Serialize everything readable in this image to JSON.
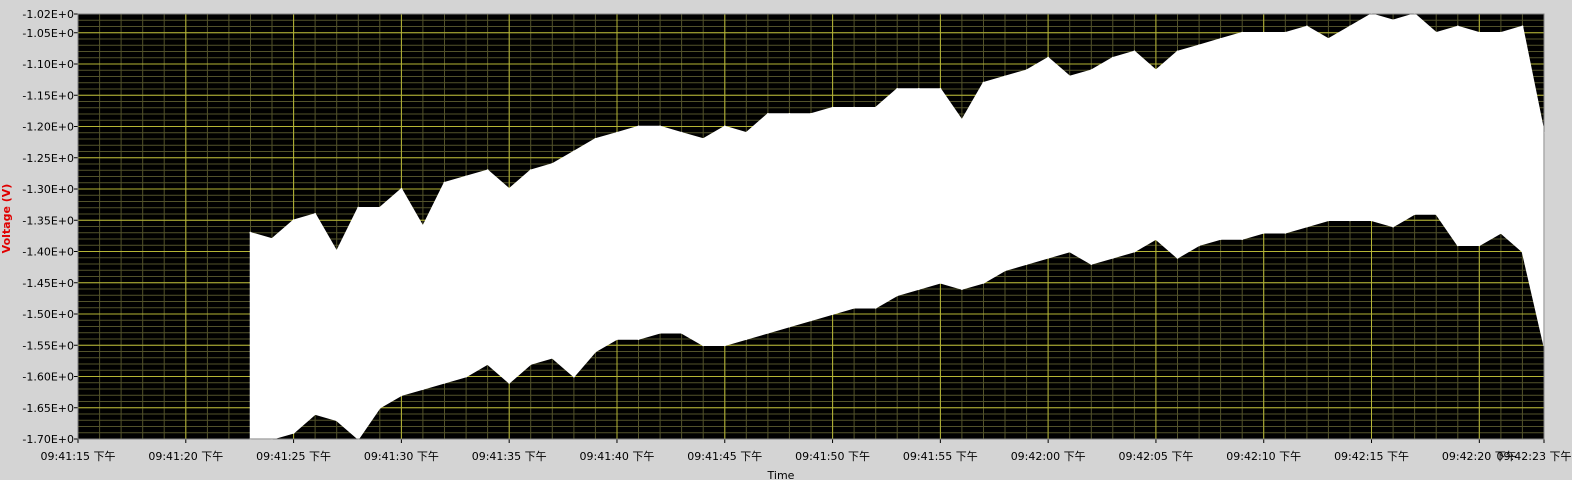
{
  "chart_data": {
    "type": "area",
    "xlabel": "Time",
    "ylabel": "Voltage (V)",
    "ylim": [
      -1.7,
      -1.02
    ],
    "xlim": [
      "09:41:15",
      "09:42:23"
    ],
    "y_ticks": [
      "-1.02E+0",
      "-1.05E+0",
      "-1.10E+0",
      "-1.15E+0",
      "-1.20E+0",
      "-1.25E+0",
      "-1.30E+0",
      "-1.35E+0",
      "-1.40E+0",
      "-1.45E+0",
      "-1.50E+0",
      "-1.55E+0",
      "-1.60E+0",
      "-1.65E+0",
      "-1.70E+0"
    ],
    "x_ticks": [
      "09:41:15 下午",
      "09:41:20 下午",
      "09:41:25 下午",
      "09:41:30 下午",
      "09:41:35 下午",
      "09:41:40 下午",
      "09:41:45 下午",
      "09:41:50 下午",
      "09:41:55 下午",
      "09:42:00 下午",
      "09:42:05 下午",
      "09:42:10 下午",
      "09:42:15 下午",
      "09:42:20 下午",
      "09:42:23 下午"
    ],
    "grid": true,
    "colors": {
      "plot_bg": "#000000",
      "grid_major": "#b5b535",
      "grid_minor": "#52522a",
      "series": "#ffffff",
      "ylabel": "#e00000",
      "frame": "#d4d4d4"
    },
    "series": [
      {
        "kind": "envelope",
        "x": [
          "09:41:23",
          "09:41:24",
          "09:41:25",
          "09:41:26",
          "09:41:27",
          "09:41:28",
          "09:41:29",
          "09:41:30",
          "09:41:31",
          "09:41:32",
          "09:41:33",
          "09:41:34",
          "09:41:35",
          "09:41:36",
          "09:41:37",
          "09:41:38",
          "09:41:39",
          "09:41:40",
          "09:41:41",
          "09:41:42",
          "09:41:43",
          "09:41:44",
          "09:41:45",
          "09:41:46",
          "09:41:47",
          "09:41:48",
          "09:41:49",
          "09:41:50",
          "09:41:51",
          "09:41:52",
          "09:41:53",
          "09:41:54",
          "09:41:55",
          "09:41:56",
          "09:41:57",
          "09:41:58",
          "09:41:59",
          "09:42:00",
          "09:42:01",
          "09:42:02",
          "09:42:03",
          "09:42:04",
          "09:42:05",
          "09:42:06",
          "09:42:07",
          "09:42:08",
          "09:42:09",
          "09:42:10",
          "09:42:11",
          "09:42:12",
          "09:42:13",
          "09:42:14",
          "09:42:15",
          "09:42:16",
          "09:42:17",
          "09:42:18",
          "09:42:19",
          "09:42:20",
          "09:42:21",
          "09:42:22",
          "09:42:23"
        ],
        "upper": [
          -1.37,
          -1.38,
          -1.35,
          -1.34,
          -1.4,
          -1.33,
          -1.33,
          -1.3,
          -1.36,
          -1.29,
          -1.28,
          -1.27,
          -1.3,
          -1.27,
          -1.26,
          -1.24,
          -1.22,
          -1.21,
          -1.2,
          -1.2,
          -1.21,
          -1.22,
          -1.2,
          -1.21,
          -1.18,
          -1.18,
          -1.18,
          -1.17,
          -1.17,
          -1.17,
          -1.14,
          -1.14,
          -1.14,
          -1.19,
          -1.13,
          -1.12,
          -1.11,
          -1.09,
          -1.12,
          -1.11,
          -1.09,
          -1.08,
          -1.11,
          -1.08,
          -1.07,
          -1.06,
          -1.05,
          -1.05,
          -1.05,
          -1.04,
          -1.06,
          -1.04,
          -1.02,
          -1.03,
          -1.02,
          -1.05,
          -1.04,
          -1.05,
          -1.05,
          -1.04,
          -1.21
        ],
        "lower": [
          -1.7,
          -1.7,
          -1.69,
          -1.66,
          -1.67,
          -1.7,
          -1.65,
          -1.63,
          -1.62,
          -1.61,
          -1.6,
          -1.58,
          -1.61,
          -1.58,
          -1.57,
          -1.6,
          -1.56,
          -1.54,
          -1.54,
          -1.53,
          -1.53,
          -1.55,
          -1.55,
          -1.54,
          -1.53,
          -1.52,
          -1.51,
          -1.5,
          -1.49,
          -1.49,
          -1.47,
          -1.46,
          -1.45,
          -1.46,
          -1.45,
          -1.43,
          -1.42,
          -1.41,
          -1.4,
          -1.42,
          -1.41,
          -1.4,
          -1.38,
          -1.41,
          -1.39,
          -1.38,
          -1.38,
          -1.37,
          -1.37,
          -1.36,
          -1.35,
          -1.35,
          -1.35,
          -1.36,
          -1.34,
          -1.34,
          -1.39,
          -1.39,
          -1.37,
          -1.4,
          -1.55
        ]
      }
    ]
  }
}
